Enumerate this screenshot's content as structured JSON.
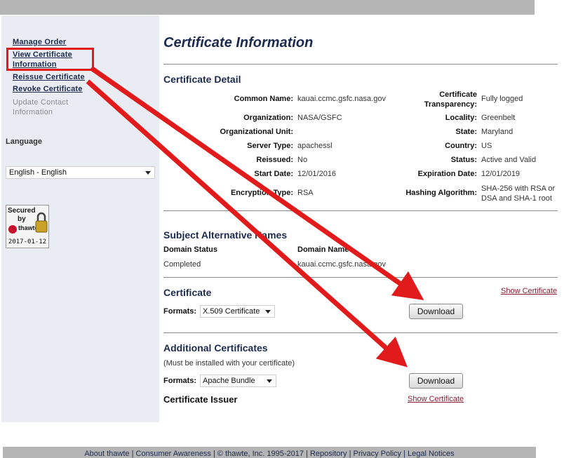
{
  "sidebar": {
    "links": [
      {
        "label": "Manage Order"
      },
      {
        "label": "View Certificate Information"
      },
      {
        "label": "Reissue Certificate"
      },
      {
        "label": "Revoke Certificate"
      }
    ],
    "disabled_link": "Update Contact Information",
    "language_label": "Language",
    "language_selected": "English - English",
    "seal": {
      "secured": "Secured",
      "by": "by",
      "brand": "thawte",
      "date": "2017-01-12"
    }
  },
  "page_title": "Certificate Information",
  "certificate_detail": {
    "title": "Certificate Detail",
    "left": [
      {
        "label": "Common Name:",
        "value": "kauai.ccmc.gsfc.nasa.gov"
      },
      {
        "label": "Organization:",
        "value": "NASA/GSFC"
      },
      {
        "label": "Organizational Unit:",
        "value": ""
      },
      {
        "label": "Server Type:",
        "value": "apachessl"
      },
      {
        "label": "Reissued:",
        "value": "No"
      },
      {
        "label": "Start Date:",
        "value": "12/01/2016"
      },
      {
        "label": "Encryption Type:",
        "value": "RSA"
      }
    ],
    "right": [
      {
        "label": "Certificate Transparency:",
        "value": "Fully logged"
      },
      {
        "label": "Locality:",
        "value": "Greenbelt"
      },
      {
        "label": "State:",
        "value": "Maryland"
      },
      {
        "label": "Country:",
        "value": "US"
      },
      {
        "label": "Status:",
        "value": "Active and Valid"
      },
      {
        "label": "Expiration Date:",
        "value": "12/01/2019"
      },
      {
        "label": "Hashing Algorithm:",
        "value": "SHA-256 with RSA or DSA and SHA-1 root"
      }
    ]
  },
  "san": {
    "title": "Subject Alternative Names",
    "col_status": "Domain Status",
    "col_name": "Domain Name",
    "rows": [
      {
        "status": "Completed",
        "name": "kauai.ccmc.gsfc.nasa.gov"
      }
    ]
  },
  "certificate": {
    "title": "Certificate",
    "show_link": "Show Certificate",
    "formats_label": "Formats:",
    "format_selected": "X.509 Certificate",
    "download_label": "Download"
  },
  "additional": {
    "title": "Additional Certificates",
    "note": "(Must be installed with your certificate)",
    "formats_label": "Formats:",
    "format_selected": "Apache Bundle",
    "download_label": "Download",
    "issuer_label": "Certificate Issuer",
    "show_link": "Show Certificate"
  },
  "footer": {
    "about": "About thawte",
    "consumer": "Consumer Awareness",
    "copyright": "© thawte, Inc. 1995-2017",
    "repository": "Repository",
    "privacy": "Privacy Policy",
    "legal": "Legal Notices"
  },
  "colors": {
    "annotation": "#e11b1b",
    "heading": "#1b2a4e",
    "link": "#8b1c2f"
  }
}
